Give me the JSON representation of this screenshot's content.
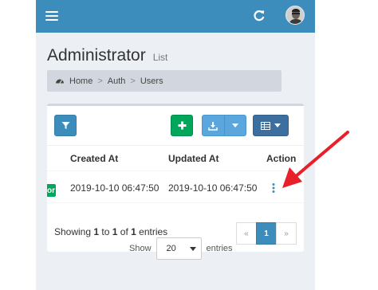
{
  "header": {
    "title": "Administrator",
    "subtitle": "List"
  },
  "breadcrumb": {
    "items": [
      "Home",
      "Auth",
      "Users"
    ]
  },
  "table": {
    "columns": [
      "Created At",
      "Updated At",
      "Action"
    ],
    "rows": [
      {
        "tag": "or",
        "created_at": "2019-10-10 06:47:50",
        "updated_at": "2019-10-10 06:47:50"
      }
    ]
  },
  "footer": {
    "info_prefix": "Showing ",
    "from": "1",
    "to_word": " to ",
    "to": "1",
    "of_word": " of ",
    "total": "1",
    "entries_word": " entries",
    "show_label": "Show",
    "per_page": "20",
    "entries_label": "entries"
  },
  "pagination": {
    "prev": "«",
    "current": "1",
    "next": "»"
  },
  "icons": {
    "menu": "menu-icon",
    "refresh": "refresh-icon",
    "filter": "filter-icon",
    "add": "plus-icon",
    "export": "download-icon",
    "columns": "table-icon",
    "action": "ellipsis-vertical-icon",
    "annotation": "red-arrow-icon"
  },
  "colors": {
    "navbar": "#3c8dbc",
    "filter_button": "#3c8dbc",
    "add_button": "#00a65a",
    "export_button": "#5ba6dc",
    "columns_button": "#3c6e9f",
    "annotation_arrow": "#e8202a"
  }
}
